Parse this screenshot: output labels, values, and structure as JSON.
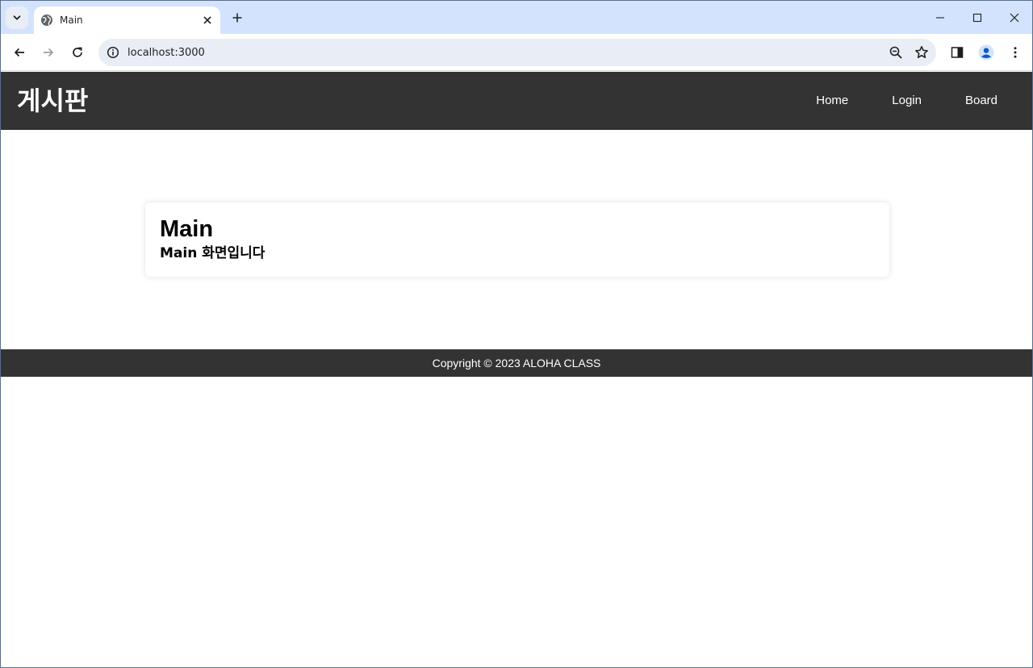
{
  "browser": {
    "tab": {
      "title": "Main"
    },
    "address": {
      "url": "localhost:3000"
    }
  },
  "navbar": {
    "brand": "게시판",
    "links": [
      {
        "label": "Home"
      },
      {
        "label": "Login"
      },
      {
        "label": "Board"
      }
    ]
  },
  "main": {
    "heading": "Main",
    "description": "Main 화면입니다"
  },
  "footer": {
    "copyright": "Copyright © 2023 ALOHA CLASS"
  },
  "colors": {
    "navbar_bg": "#333333",
    "tabstrip_bg": "#d3e3fd",
    "omnibox_bg": "#e9eef6",
    "profile_accent": "#0b57d0"
  }
}
